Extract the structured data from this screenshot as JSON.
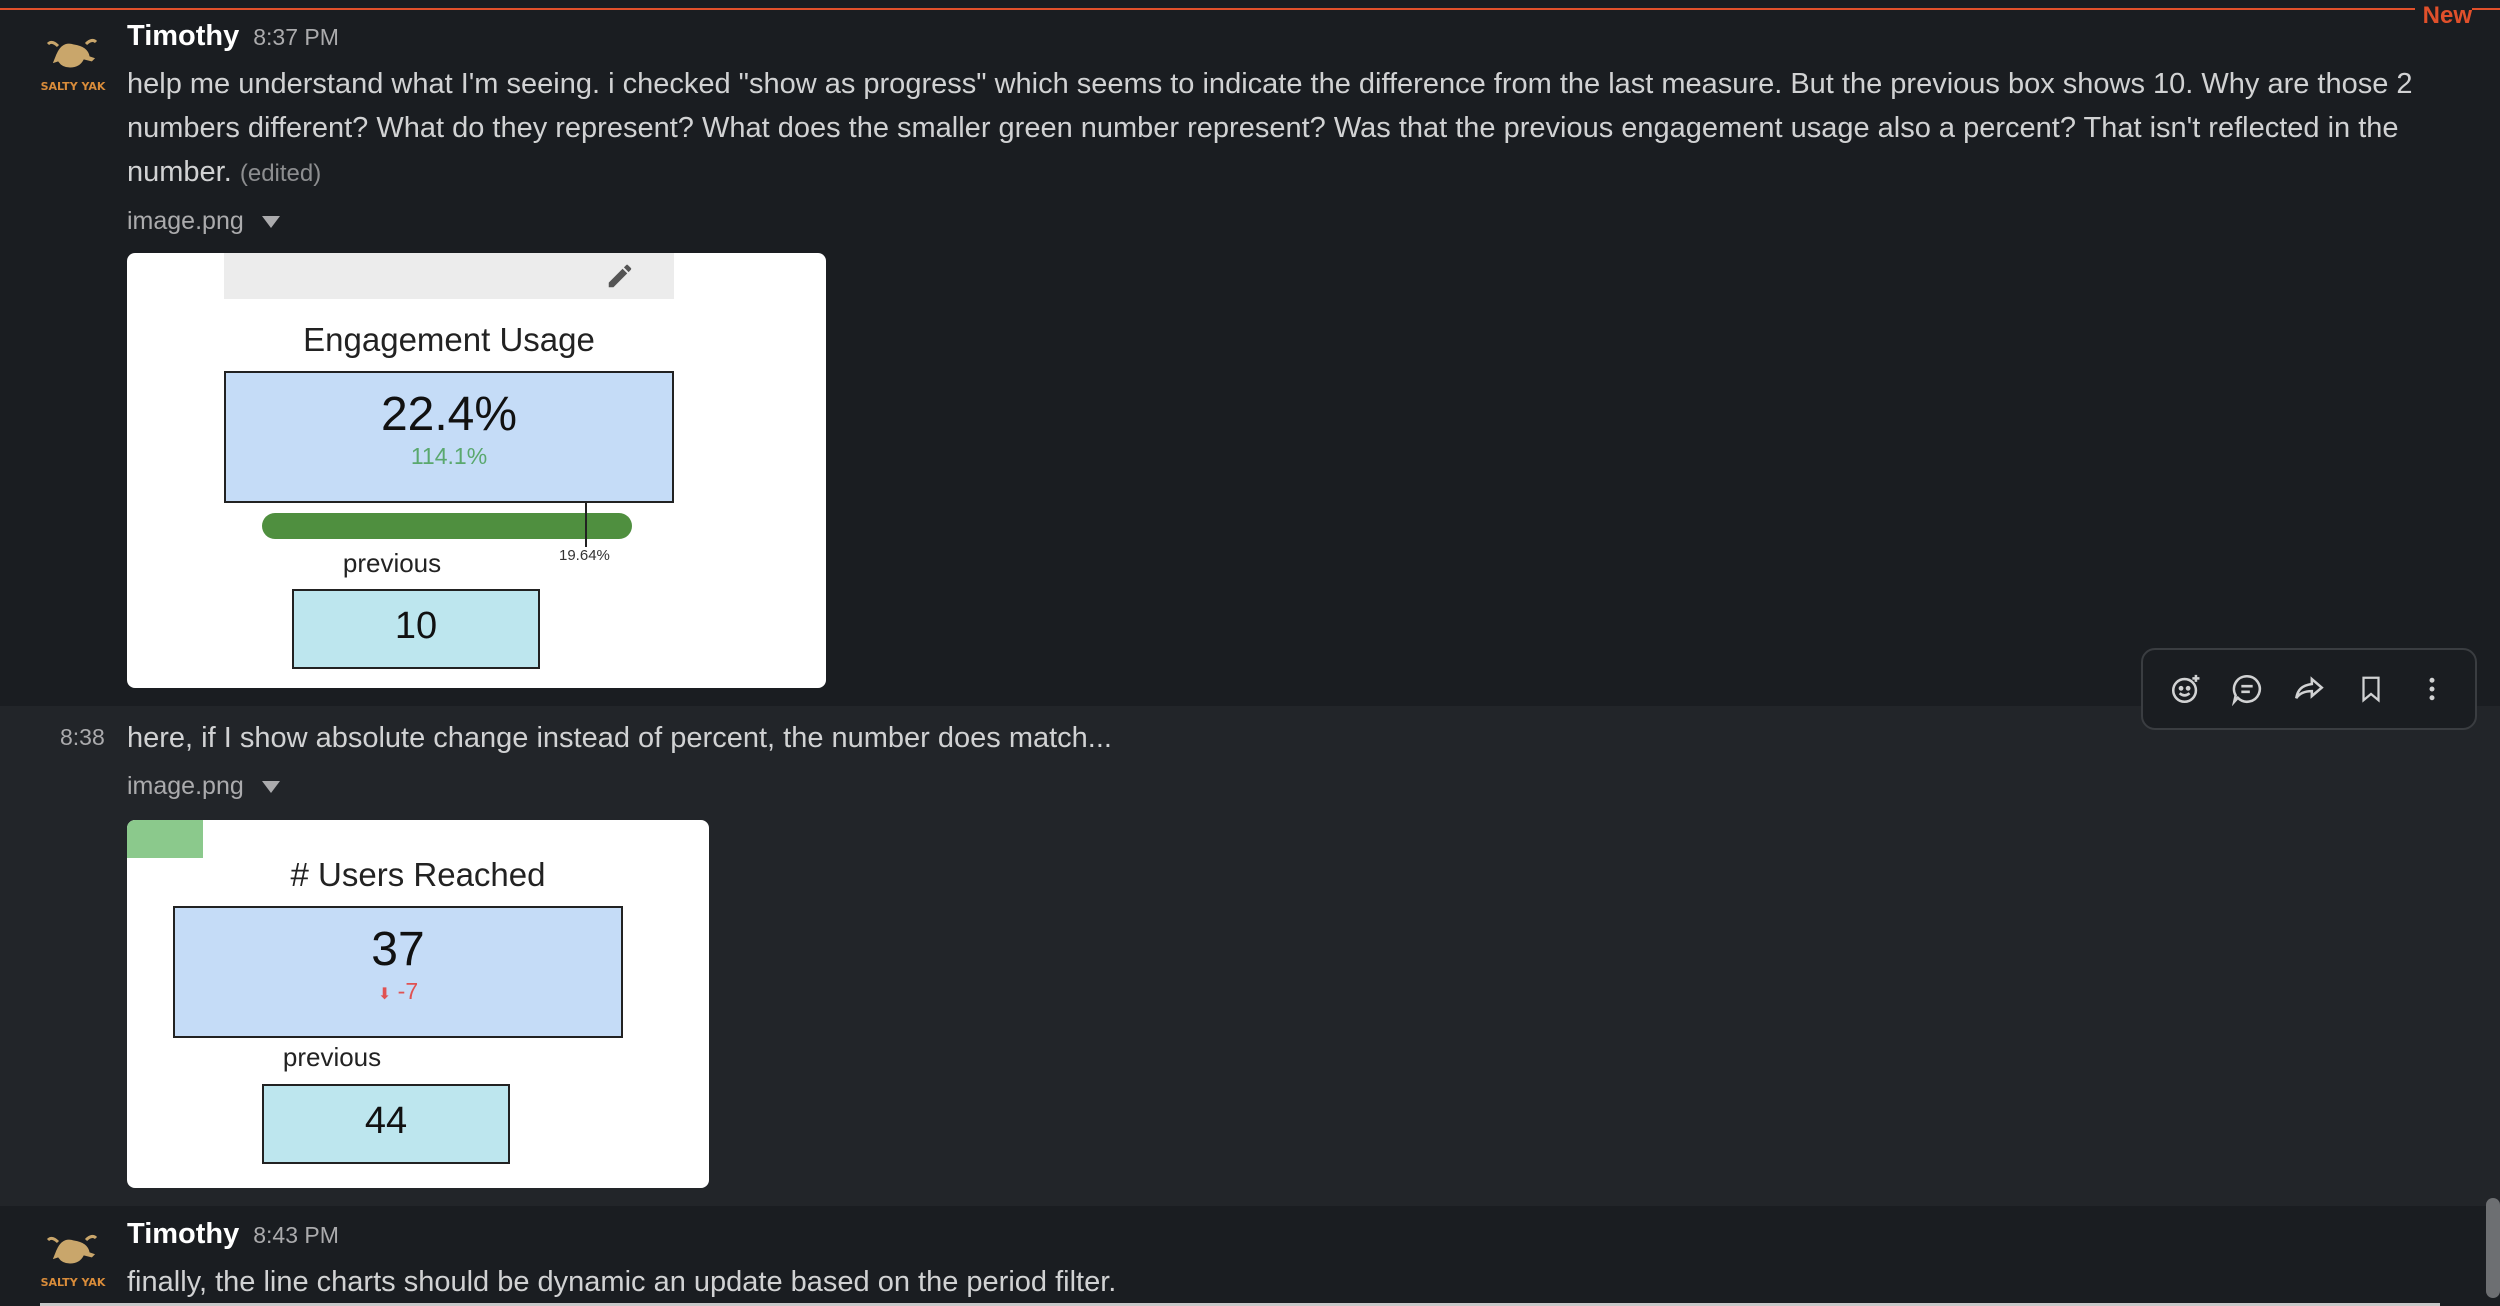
{
  "new_divider": {
    "label": "New"
  },
  "messages": [
    {
      "author": "Timothy",
      "time": "8:37 PM",
      "text": "help me understand what I'm seeing. i checked \"show as progress\" which seems to indicate the difference from the last measure. But the previous box shows 10. Why are those 2 numbers different? What do they represent? What does the smaller green number represent? Was that the previous engagement usage also a percent? That isn't reflected in the number.",
      "edited": "(edited)",
      "file": "image.png",
      "card": {
        "title": "Engagement Usage",
        "value": "22.4%",
        "delta": "114.1%",
        "progress_marker_label": "19.64%",
        "previous_label": "previous",
        "previous_value": "10"
      }
    },
    {
      "time": "8:38",
      "text": "here, if I show absolute change instead of percent, the number does match...",
      "file": "image.png",
      "card": {
        "title": "# Users Reached",
        "value": "37",
        "delta": "-7",
        "previous_label": "previous",
        "previous_value": "44"
      }
    },
    {
      "author": "Timothy",
      "time": "8:43 PM",
      "text": "finally, the line charts should be dynamic an update based on the period filter."
    }
  ],
  "avatar": {
    "label": "SALTY YAK"
  },
  "colors": {
    "background": "#1a1d21",
    "new_divider": "#e0502b",
    "value_box": "#c5dcf7",
    "previous_box": "#bde6ee",
    "progress_green": "#4f8f3f",
    "delta_green": "#5aa86e",
    "delta_red": "#e05252"
  }
}
